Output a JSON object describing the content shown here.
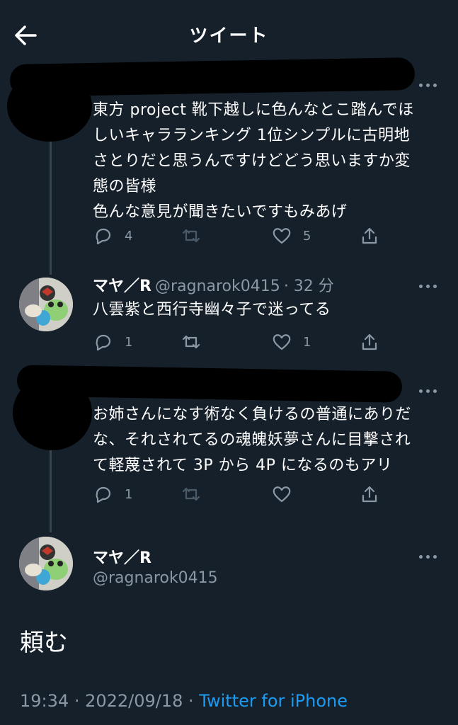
{
  "header": {
    "title": "ツイート"
  },
  "tweets": [
    {
      "text_lines": [
        "東方 project 靴下越しに色んなとこ踏んでほ",
        "しいキャラランキング 1位シンプルに古明地",
        "さとりだと思うんですけどどう思いますか変",
        "態の皆様",
        "色んな意見が聞きたいですもみあげ"
      ],
      "reply_count": "4",
      "retweet_count": "",
      "like_count": "5"
    },
    {
      "name": "マヤ／R",
      "handle": "@ragnarok0415",
      "time": "· 32 分",
      "text_lines": [
        "八雲紫と西行寺幽々子で迷ってる"
      ],
      "reply_count": "1",
      "retweet_count": "",
      "like_count": "1"
    },
    {
      "text_lines": [
        "お姉さんになす術なく負けるの普通にありだ",
        "な、それされてるの魂魄妖夢さんに目撃され",
        "て軽蔑されて 3P から 4P になるのもアリ"
      ],
      "reply_count": "1",
      "retweet_count": "",
      "like_count": ""
    }
  ],
  "main_tweet": {
    "name": "マヤ／R",
    "handle": "@ragnarok0415",
    "text": "頼む",
    "time": "19:34",
    "date": "· 2022/09/18 ·",
    "source": "Twitter for iPhone"
  },
  "colors": {
    "background": "#15202b",
    "secondary_text": "#8b98a5",
    "link": "#1d9bf0"
  }
}
